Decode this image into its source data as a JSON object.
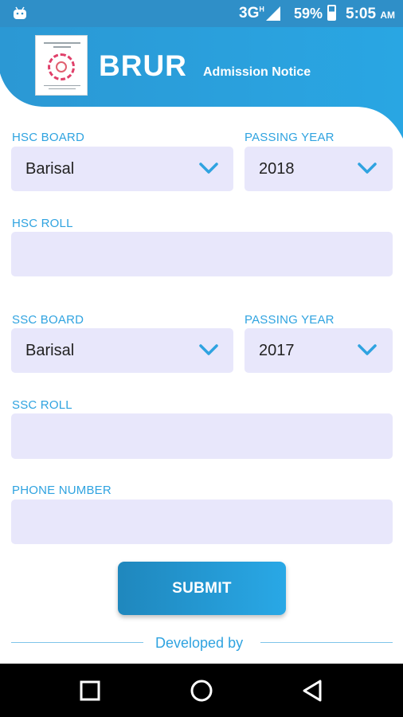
{
  "status_bar": {
    "network": "3G",
    "network_sup": "H",
    "battery_percent": "59%",
    "battery_level": 0.59,
    "time": "5:05",
    "ampm": "AM"
  },
  "header": {
    "brand": "BRUR",
    "tagline": "Admission Notice",
    "accent_color": "#2fa3e0"
  },
  "form": {
    "hsc_board": {
      "label": "HSC BOARD",
      "selected": "Barisal"
    },
    "hsc_passing_year": {
      "label": "PASSING YEAR",
      "selected": "2018"
    },
    "hsc_roll": {
      "label": "HSC ROLL",
      "value": ""
    },
    "ssc_board": {
      "label": "SSC BOARD",
      "selected": "Barisal"
    },
    "ssc_passing_year": {
      "label": "PASSING YEAR",
      "selected": "2017"
    },
    "ssc_roll": {
      "label": "SSC ROLL",
      "value": ""
    },
    "phone_number": {
      "label": "PHONE NUMBER",
      "value": ""
    },
    "submit_label": "SUBMIT"
  },
  "footer": {
    "text": "Developed by"
  },
  "nav": {
    "icons": [
      "recents-icon",
      "home-icon",
      "back-icon"
    ]
  }
}
